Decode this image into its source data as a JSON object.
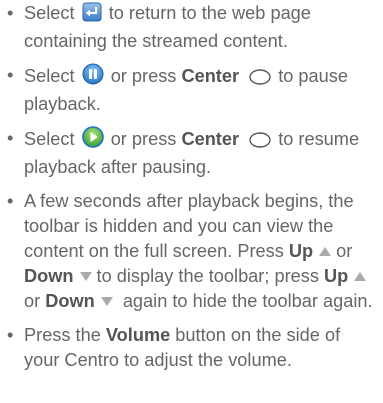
{
  "bullets": [
    {
      "pre": "Select",
      "icon": "back-arrow-icon",
      "post": "to return to the web page containing the streamed content."
    },
    {
      "pre": "Select",
      "icon": "pause-icon",
      "mid": "or press",
      "bold": "Center",
      "key_icon": "center-button-icon",
      "post": "to pause playback."
    },
    {
      "pre": "Select",
      "icon": "play-icon",
      "mid": "or press",
      "bold": "Center",
      "key_icon": "center-button-icon",
      "post": "to resume playback after pausing."
    },
    {
      "text": "A few seconds after playback begins, the toolbar is hidden and you can view the content on the full screen. Press",
      "up": "Up",
      "or1": "or",
      "down": "Down",
      "mid": "to display the toolbar; press",
      "up2": "Up",
      "or2": "or",
      "down2": "Down",
      "post": "again to hide the toolbar again."
    },
    {
      "pre": "Press the",
      "bold": "Volume",
      "post": "button on the side of your Centro to adjust the volume."
    }
  ],
  "colors": {
    "text": "#666666",
    "icon_blue": "#2a7fd4",
    "icon_green": "#3aa53a",
    "triangle": "#aaaaaa"
  }
}
